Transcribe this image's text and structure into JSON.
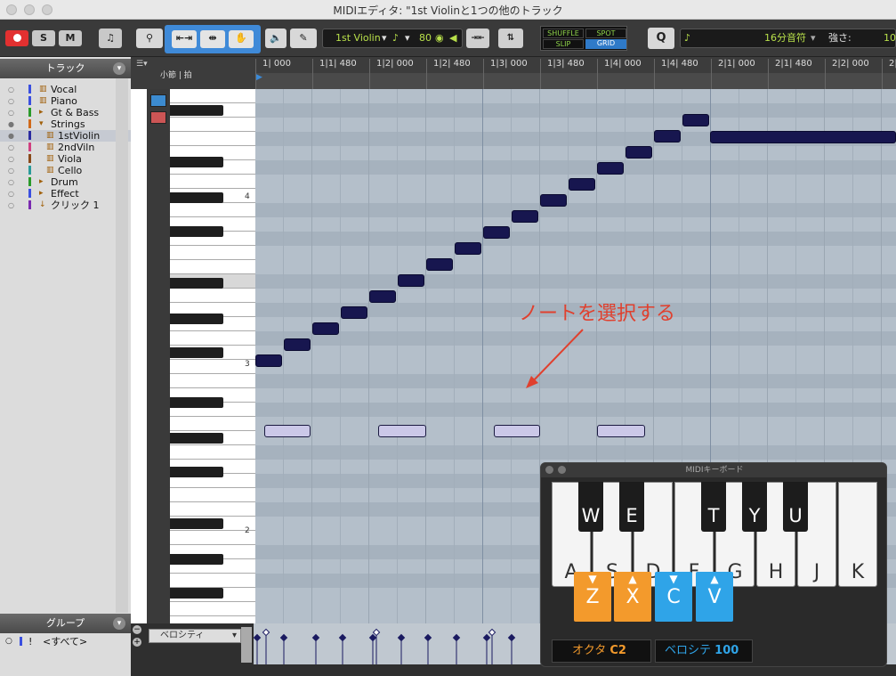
{
  "window": {
    "title": "MIDIエディタ: \"1st Violinと1つの他のトラック"
  },
  "toolbar": {
    "solo": "S",
    "mute": "M",
    "track_name": "1st Violin",
    "tempo": "80",
    "shuffle": "SHUFFLE",
    "spot": "SPOT",
    "slip": "SLIP",
    "grid": "GRID",
    "q": "Q",
    "grid_value": "16分音符",
    "velocity_label": "強さ:",
    "velocity_value": "10"
  },
  "sidebar": {
    "tracks_header": "トラック",
    "tracks": [
      {
        "name": "Vocal",
        "color": "#3a4fe0"
      },
      {
        "name": "Piano",
        "color": "#3a4fe0"
      },
      {
        "name": "Gt & Bass",
        "color": "#2a9a2a"
      },
      {
        "name": "Strings",
        "color": "#d06a1a"
      },
      {
        "name": "1stViolin",
        "color": "#2a2aa0"
      },
      {
        "name": "2ndViln",
        "color": "#d04080"
      },
      {
        "name": "Viola",
        "color": "#8a4a1a"
      },
      {
        "name": "Cello",
        "color": "#2a9a9a"
      },
      {
        "name": "Drum",
        "color": "#2a9a2a"
      },
      {
        "name": "Effect",
        "color": "#3a4fe0"
      },
      {
        "name": "クリック 1",
        "color": "#7a2ab0"
      }
    ],
    "groups_header": "グループ",
    "group_all": "<すべて>"
  },
  "ruler": {
    "label": "小節 | 拍",
    "ticks": [
      "1| 000",
      "1|1| 480",
      "1|2| 000",
      "1|2| 480",
      "1|3| 000",
      "1|3| 480",
      "1|4| 000",
      "1|4| 480",
      "2|1| 000",
      "2|1| 480",
      "2|2| 000",
      "2|"
    ]
  },
  "piano": {
    "c_labels": [
      "4",
      "3",
      "2"
    ]
  },
  "annotation": "ノートを選択する",
  "velocity_lane": {
    "selector": "ベロシティ"
  },
  "midi_keyboard": {
    "title": "MIDIキーボード",
    "white_keys": [
      "A",
      "S",
      "D",
      "F",
      "G",
      "H",
      "J",
      "K"
    ],
    "black_keys": [
      "W",
      "E",
      "T",
      "Y",
      "U"
    ],
    "octave_buttons": [
      "Z",
      "X"
    ],
    "velocity_buttons": [
      "C",
      "V"
    ],
    "octave_label": "オクタ",
    "octave_value": "C2",
    "velocity_label": "ベロシテ",
    "velocity_value": "100"
  },
  "colors": {
    "note": "#17164f",
    "note_light": "#cbc8e8",
    "accent_orange": "#f39a2c",
    "accent_blue": "#2fa4e8"
  }
}
